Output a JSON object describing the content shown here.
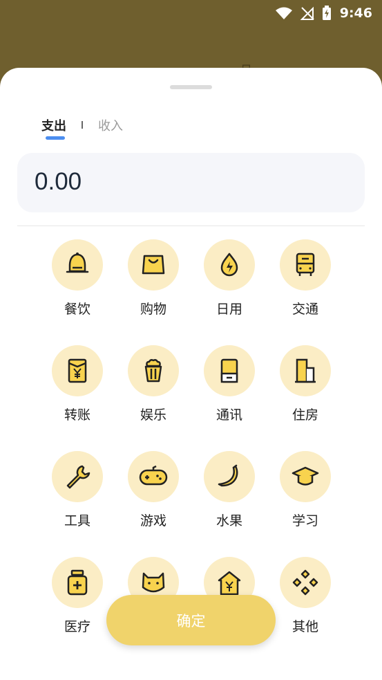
{
  "status_bar": {
    "time": "9:46"
  },
  "background": {
    "ghost_text": "- 月"
  },
  "tabs": [
    {
      "label": "支出",
      "active": true
    },
    {
      "label": "收入",
      "active": false
    }
  ],
  "amount": "0.00",
  "categories": [
    {
      "label": "餐饮",
      "icon": "bell-icon"
    },
    {
      "label": "购物",
      "icon": "shopping-bag-icon"
    },
    {
      "label": "日用",
      "icon": "flame-icon"
    },
    {
      "label": "交通",
      "icon": "bus-icon"
    },
    {
      "label": "转账",
      "icon": "yen-card-icon"
    },
    {
      "label": "娱乐",
      "icon": "popcorn-icon"
    },
    {
      "label": "通讯",
      "icon": "phone-icon"
    },
    {
      "label": "住房",
      "icon": "building-icon"
    },
    {
      "label": "工具",
      "icon": "wrench-icon"
    },
    {
      "label": "游戏",
      "icon": "gamepad-icon"
    },
    {
      "label": "水果",
      "icon": "banana-icon"
    },
    {
      "label": "学习",
      "icon": "graduation-cap-icon"
    },
    {
      "label": "医疗",
      "icon": "medicine-bottle-icon"
    },
    {
      "label": "",
      "icon": "cat-icon"
    },
    {
      "label": "",
      "icon": "yen-house-icon"
    },
    {
      "label": "其他",
      "icon": "diamonds-icon"
    }
  ],
  "confirm_label": "确定",
  "colors": {
    "accent": "#4c8ef0",
    "icon_bg": "#fbedc5",
    "icon_fill": "#f8d34e",
    "button": "#f0d36b"
  }
}
